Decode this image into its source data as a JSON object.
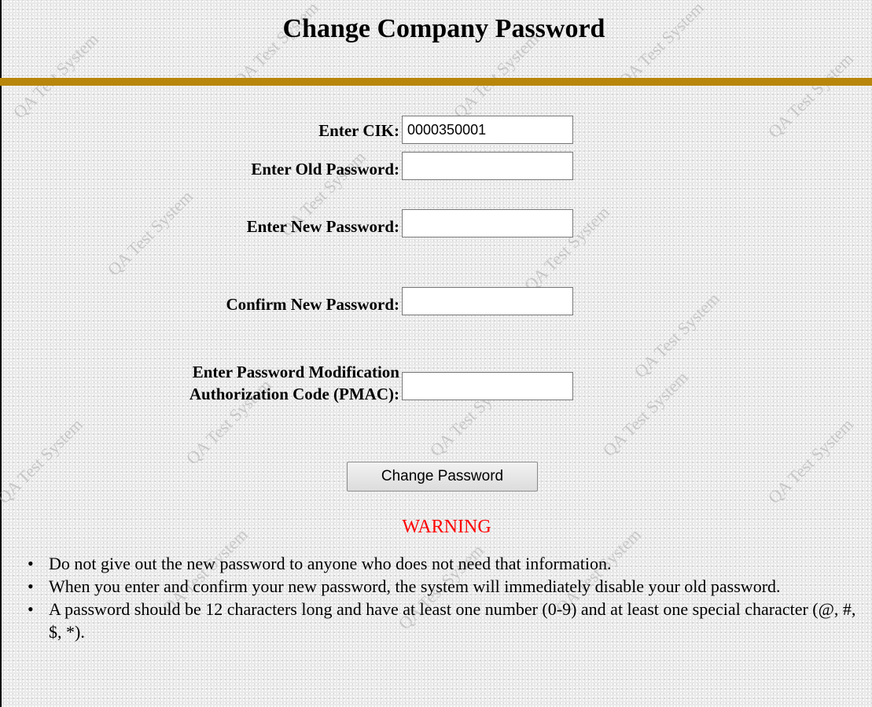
{
  "page": {
    "title": "Change Company Password",
    "watermark_text": "QA Test System"
  },
  "form": {
    "cik": {
      "label": "Enter CIK:",
      "value": "0000350001"
    },
    "old_password": {
      "label": "Enter Old Password:",
      "value": ""
    },
    "new_password": {
      "label": "Enter New Password:",
      "value": ""
    },
    "confirm_password": {
      "label": "Confirm New Password:",
      "value": ""
    },
    "pmac": {
      "label_line1": "Enter Password Modification",
      "label_line2": "Authorization Code (PMAC):",
      "value": ""
    },
    "submit_label": "Change Password"
  },
  "warning": {
    "heading": "WARNING",
    "items": [
      "Do not give out the new password to anyone who does not need that information.",
      "When you enter and confirm your new password, the system will immediately disable your old password.",
      "A password should be 12 characters long and have at least one number (0-9) and at least one special character (@, #, $, *)."
    ]
  },
  "colors": {
    "rule": "#b8860b",
    "warning": "#ff0000",
    "background": "#e9e9e9"
  }
}
